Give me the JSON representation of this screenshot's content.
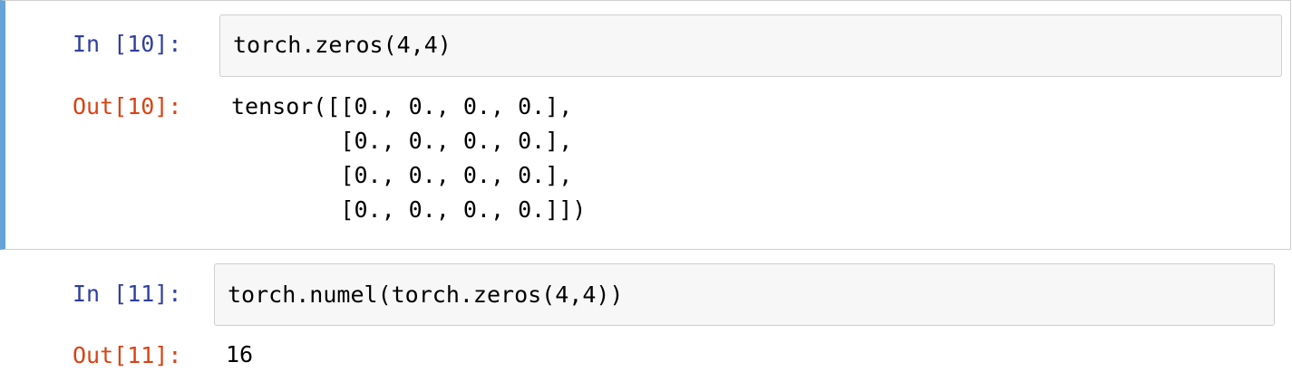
{
  "cells": [
    {
      "in_prompt": "In [10]:",
      "code": "torch.zeros(4,4)",
      "out_prompt": "Out[10]:",
      "output": "tensor([[0., 0., 0., 0.],\n        [0., 0., 0., 0.],\n        [0., 0., 0., 0.],\n        [0., 0., 0., 0.]])"
    },
    {
      "in_prompt": "In [11]:",
      "code": "torch.numel(torch.zeros(4,4))",
      "out_prompt": "Out[11]:",
      "output": "16"
    }
  ],
  "colors": {
    "selected_cell_bar": "#66a3d6",
    "in_prompt": "#303f9f",
    "out_prompt": "#d84315",
    "input_background": "#f7f7f7"
  }
}
